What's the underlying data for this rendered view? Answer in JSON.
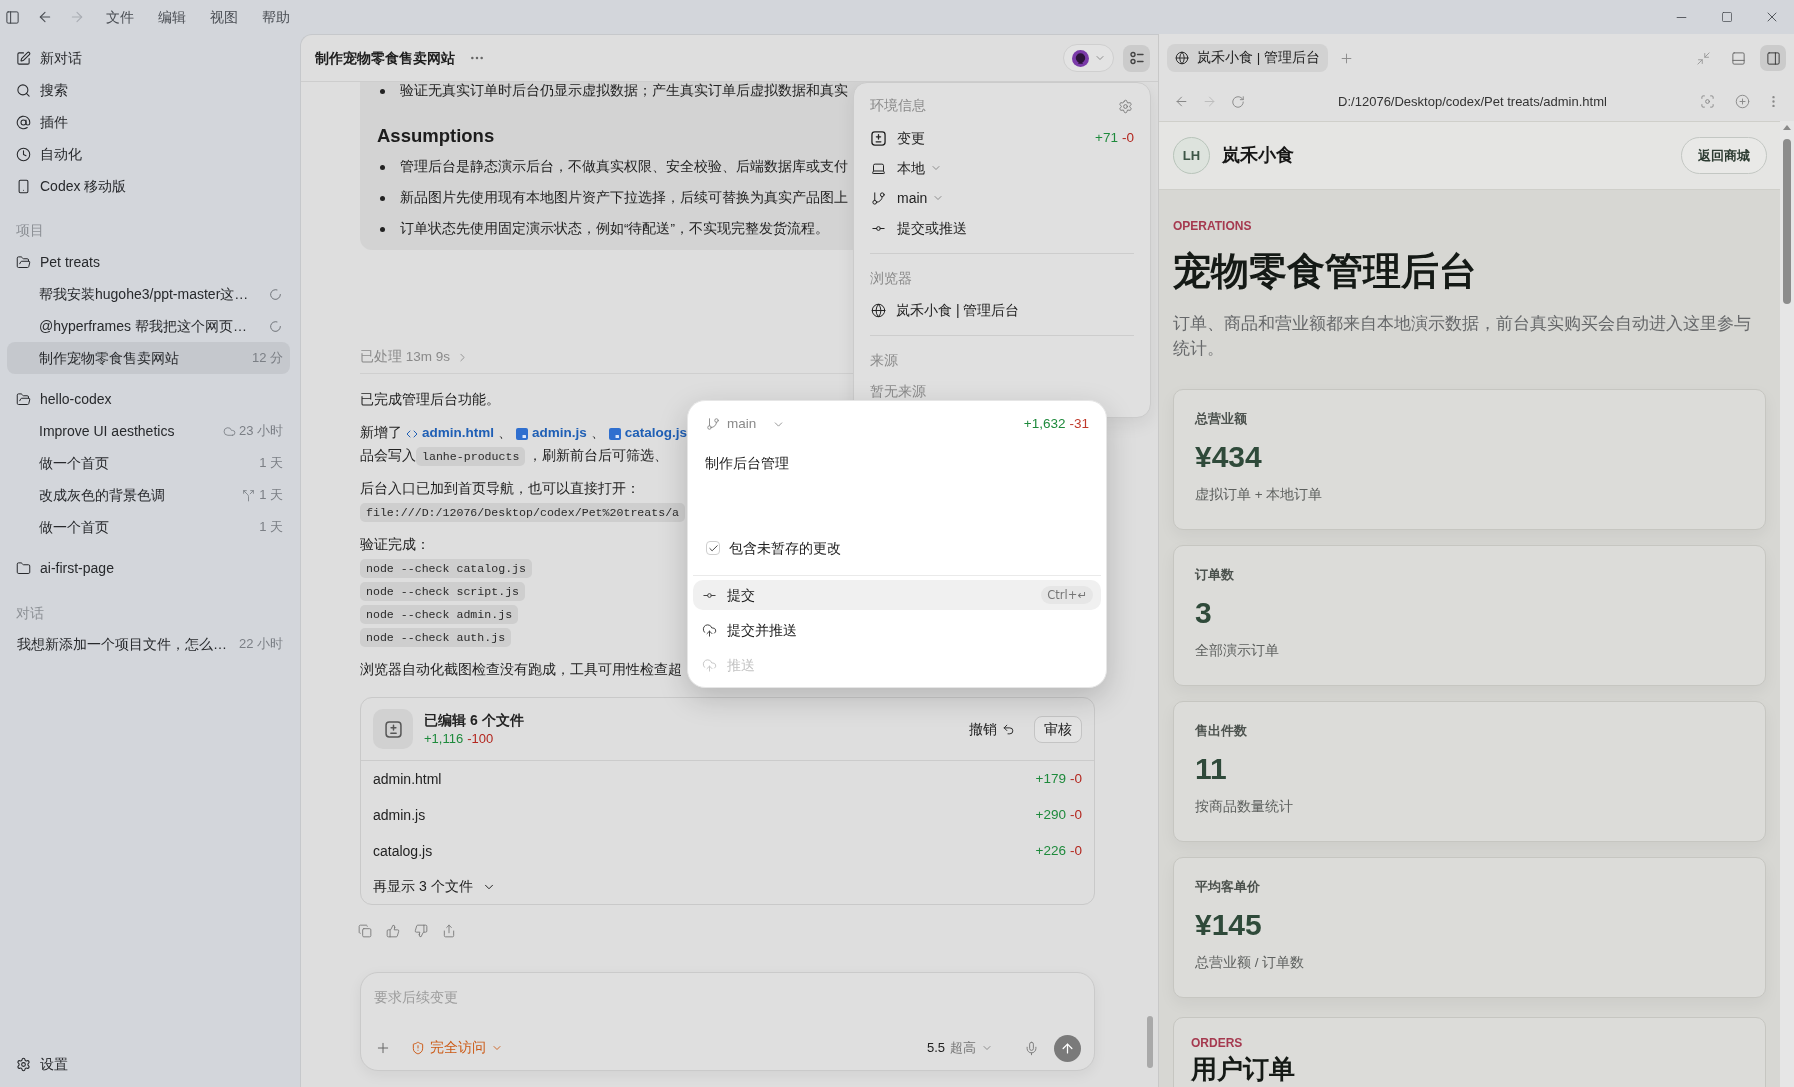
{
  "title_bar": {
    "menu": [
      "文件",
      "编辑",
      "视图",
      "帮助"
    ],
    "back_disabled": false,
    "forward_disabled": true
  },
  "sidebar": {
    "nav": [
      {
        "kind": "new_chat",
        "label": "新对话"
      },
      {
        "kind": "search",
        "label": "搜索"
      },
      {
        "kind": "plugins",
        "label": "插件"
      },
      {
        "kind": "automation",
        "label": "自动化"
      },
      {
        "kind": "mobile",
        "label": "Codex 移动版"
      }
    ],
    "projects_heading": "项目",
    "projects": [
      {
        "name": "Pet treats",
        "expanded": true,
        "threads": [
          {
            "title": "帮我安装hugohe3/ppt-master这…",
            "kind": "running",
            "selected": false
          },
          {
            "title": "@hyperframes 帮我把这个网页…",
            "kind": "running",
            "selected": false
          },
          {
            "title": "制作宠物零食售卖网站",
            "kind": "plain",
            "time": "12 分",
            "selected": true
          }
        ]
      },
      {
        "name": "hello-codex",
        "expanded": true,
        "threads": [
          {
            "title": "Improve UI aesthetics",
            "kind": "cloud",
            "time": "23 小时",
            "selected": false
          },
          {
            "title": "做一个首页",
            "kind": "plain",
            "time": "1 天",
            "selected": false
          },
          {
            "title": "改成灰色的背景色调",
            "kind": "forked",
            "time": "1 天",
            "selected": false
          },
          {
            "title": "做一个首页",
            "kind": "plain",
            "time": "1 天",
            "selected": false
          }
        ]
      },
      {
        "name": "ai-first-page",
        "expanded": false
      }
    ],
    "chats_heading": "对话",
    "chats": [
      {
        "title": "我想新添加一个项目文件，怎么…",
        "time": "22 小时",
        "selected": false
      }
    ],
    "settings": "设置"
  },
  "main_panel": {
    "title": "制作宠物零食售卖网站",
    "panel_toggle_on": true,
    "plan": {
      "bullets": [
        "验证无真实订单时后台仍显示虚拟数据；产生真实订单后虚拟数据和真实"
      ],
      "heading": "Assumptions",
      "assumptions": [
        "管理后台是静态演示后台，不做真实权限、安全校验、后端数据库或支付",
        "新品图片先使用现有本地图片资产下拉选择，后续可替换为真实产品图上",
        "订单状态先使用固定演示状态，例如“待配送”，不实现完整发货流程。"
      ]
    },
    "worked": "已处理 13m 9s",
    "message": [
      {
        "lines": [
          [
            {
              "kind": "text",
              "text": "已完成管理后台功能。"
            }
          ]
        ]
      },
      {
        "lines": [
          [
            {
              "kind": "text",
              "text": "新增了"
            },
            {
              "kind": "html_link",
              "text": "admin.html"
            },
            {
              "kind": "text",
              "text": "、"
            },
            {
              "kind": "js_link",
              "text": "admin.js"
            },
            {
              "kind": "text",
              "text": "、"
            },
            {
              "kind": "js_link",
              "text": "catalog.js"
            }
          ],
          [
            {
              "kind": "text",
              "text": "品会写入"
            },
            {
              "kind": "code",
              "text": "lanhe-products"
            },
            {
              "kind": "text",
              "text": "，刷新前台后可筛选、"
            }
          ]
        ]
      },
      {
        "lines": [
          [
            {
              "kind": "text",
              "text": "后台入口已加到首页导航，也可以直接打开："
            }
          ],
          [
            {
              "kind": "code",
              "text": "file:///D:/12076/Desktop/codex/Pet%20treats/a"
            }
          ]
        ]
      },
      {
        "lines": [
          [
            {
              "kind": "text",
              "text": "验证完成："
            }
          ],
          [
            {
              "kind": "code",
              "text": "node --check catalog.js"
            }
          ],
          [
            {
              "kind": "code",
              "text": "node --check script.js"
            }
          ],
          [
            {
              "kind": "code",
              "text": "node --check admin.js"
            }
          ],
          [
            {
              "kind": "code",
              "text": "node --check auth.js"
            }
          ]
        ]
      },
      {
        "lines": [
          [
            {
              "kind": "text",
              "text": "浏览器自动化截图检查没有跑成，工具可用性检查超"
            }
          ]
        ]
      }
    ],
    "changes": {
      "title": "已编辑 6 个文件",
      "added": "+1,116",
      "removed": "-100",
      "undo": "撤销",
      "review": "审核",
      "files": [
        {
          "name": "admin.html",
          "added": "+179",
          "removed": "-0"
        },
        {
          "name": "admin.js",
          "added": "+290",
          "removed": "-0"
        },
        {
          "name": "catalog.js",
          "added": "+226",
          "removed": "-0"
        }
      ],
      "more": "再显示 3 个文件"
    },
    "composer": {
      "placeholder": "要求后续变更",
      "access": "完全访问",
      "model": "5.5",
      "effort": "超高"
    }
  },
  "environment_panel": {
    "title": "环境信息",
    "rows": [
      {
        "kind": "changes",
        "label": "变更",
        "added": "+71",
        "removed": "-0"
      },
      {
        "kind": "local",
        "label": "本地"
      },
      {
        "kind": "branch",
        "label": "main"
      },
      {
        "kind": "commit",
        "label": "提交或推送"
      }
    ],
    "browser_heading": "浏览器",
    "browser_page": "岚禾小食 | 管理后台",
    "source_heading": "来源",
    "source_empty": "暂无来源"
  },
  "commit_popup": {
    "branch": "main",
    "added": "+1,632",
    "removed": "-31",
    "message": "制作后台管理",
    "include_unstaged": {
      "label": "包含未暂存的更改",
      "checked": true
    },
    "actions": [
      {
        "kind": "commit",
        "label": "提交",
        "shortcut": "Ctrl+↵",
        "selected": true,
        "disabled": false
      },
      {
        "kind": "commit_push",
        "label": "提交并推送",
        "selected": false,
        "disabled": false
      },
      {
        "kind": "push",
        "label": "推送",
        "selected": false,
        "disabled": true
      }
    ]
  },
  "browser": {
    "tabs": [
      {
        "title": "岚禾小食 | 管理后台",
        "selected": true
      }
    ],
    "toolbar": [
      {
        "kind": "shrink",
        "on": false
      },
      {
        "kind": "bottom_panel",
        "on": false
      },
      {
        "kind": "side_panel",
        "on": true
      }
    ],
    "back_disabled": false,
    "forward_disabled": true,
    "url": "D:/12076/Desktop/codex/Pet treats/admin.html",
    "page": {
      "brand_initials": "LH",
      "brand_name": "岚禾小食",
      "back_link": "返回商城",
      "eyebrow": "OPERATIONS",
      "heading": "宠物零食管理后台",
      "description": "订单、商品和营业额都来自本地演示数据，前台真实购买会自动进入这里参与统计。",
      "stats": [
        {
          "label": "总营业额",
          "value": "¥434",
          "note": "虚拟订单 + 本地订单"
        },
        {
          "label": "订单数",
          "value": "3",
          "note": "全部演示订单"
        },
        {
          "label": "售出件数",
          "value": "11",
          "note": "按商品数量统计"
        },
        {
          "label": "平均客单价",
          "value": "¥145",
          "note": "总营业额 / 订单数"
        }
      ],
      "orders": {
        "eyebrow": "ORDERS",
        "heading": "用户订单"
      }
    }
  }
}
